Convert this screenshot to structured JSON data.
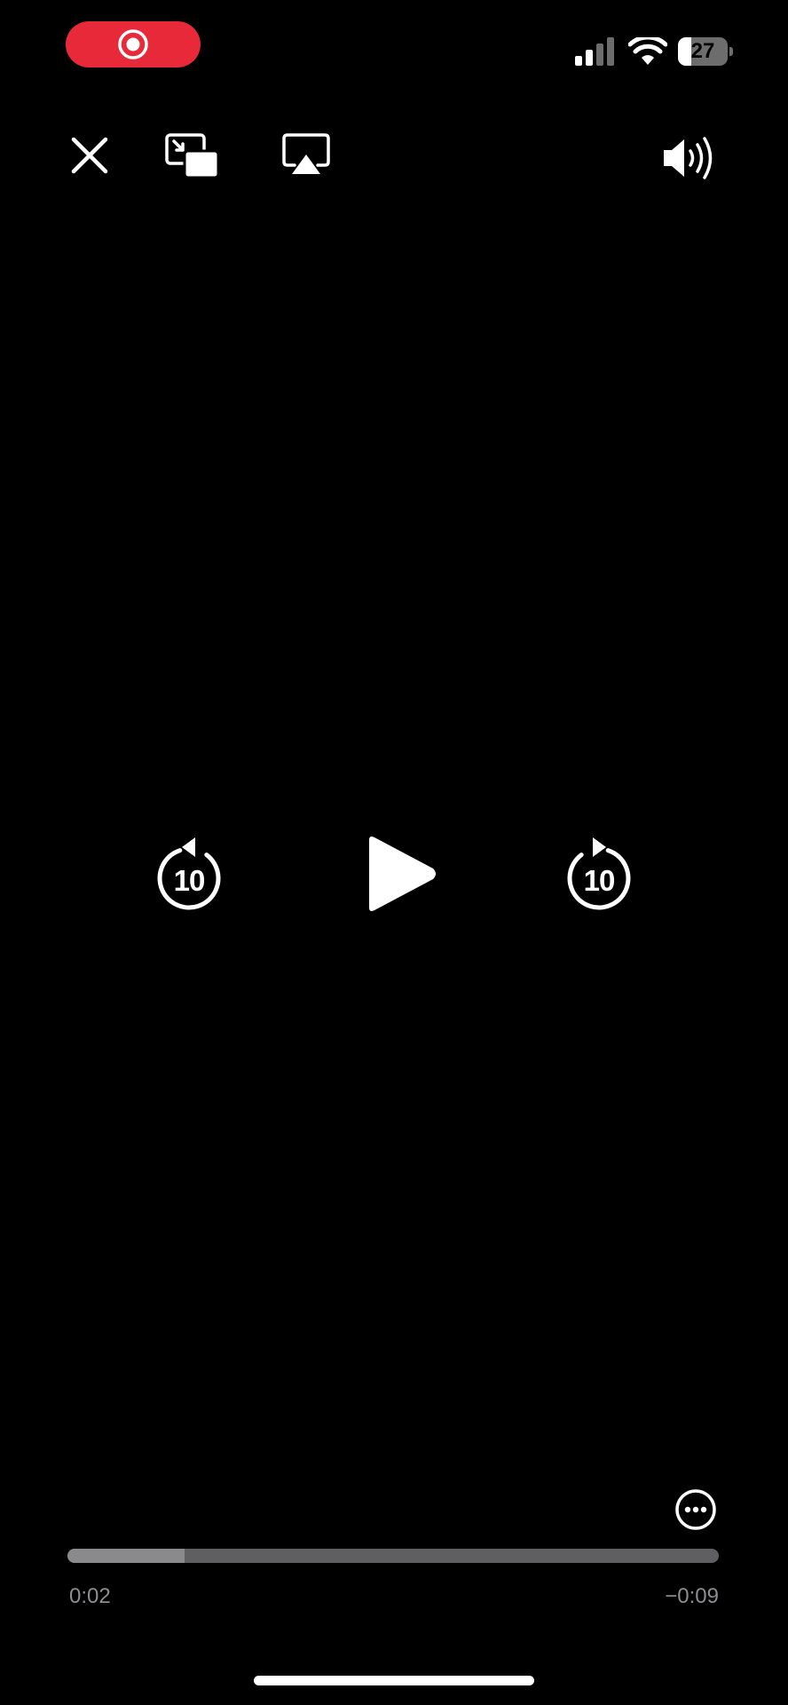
{
  "status_bar": {
    "recording_indicator": "record-icon",
    "signal_icon": "cellular-signal-icon",
    "wifi_icon": "wifi-icon",
    "battery_level": "27",
    "battery_fraction": 0.27,
    "recording_color": "#e8293a"
  },
  "toolbar": {
    "close_icon": "close-icon",
    "pip_icon": "picture-in-picture-icon",
    "airplay_icon": "airplay-icon",
    "volume_icon": "speaker-volume-icon"
  },
  "playback_controls": {
    "skip_back_label": "10",
    "skip_forward_label": "10",
    "play_icon": "play-icon"
  },
  "timeline": {
    "elapsed": "0:02",
    "remaining": "−0:09",
    "progress_fraction": 0.18
  },
  "more_icon": "ellipsis-icon"
}
